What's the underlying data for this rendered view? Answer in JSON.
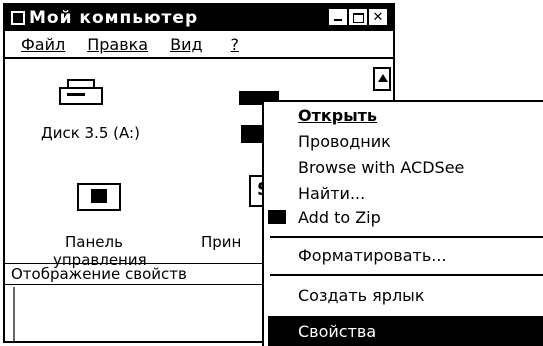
{
  "window": {
    "title": "Мой компьютер",
    "menu": {
      "file": "Файл",
      "edit": "Правка",
      "view": "Вид",
      "help": "?"
    }
  },
  "icons": {
    "floppy": {
      "label": "Диск 3.5 (A:)"
    },
    "control_panel": {
      "label_line1": "Панель",
      "label_line2": "управления"
    },
    "printers": {
      "label": "Прин"
    }
  },
  "status_bar": {
    "text": "Отображение свойств"
  },
  "context_menu": {
    "open": "Открыть",
    "explorer": "Проводник",
    "browse_acdsee": "Browse with ACDSee",
    "find": "Найти...",
    "add_to_zip": "Add to Zip",
    "format": "Форматировать...",
    "create_shortcut": "Создать ярлык",
    "properties": "Свойства"
  }
}
